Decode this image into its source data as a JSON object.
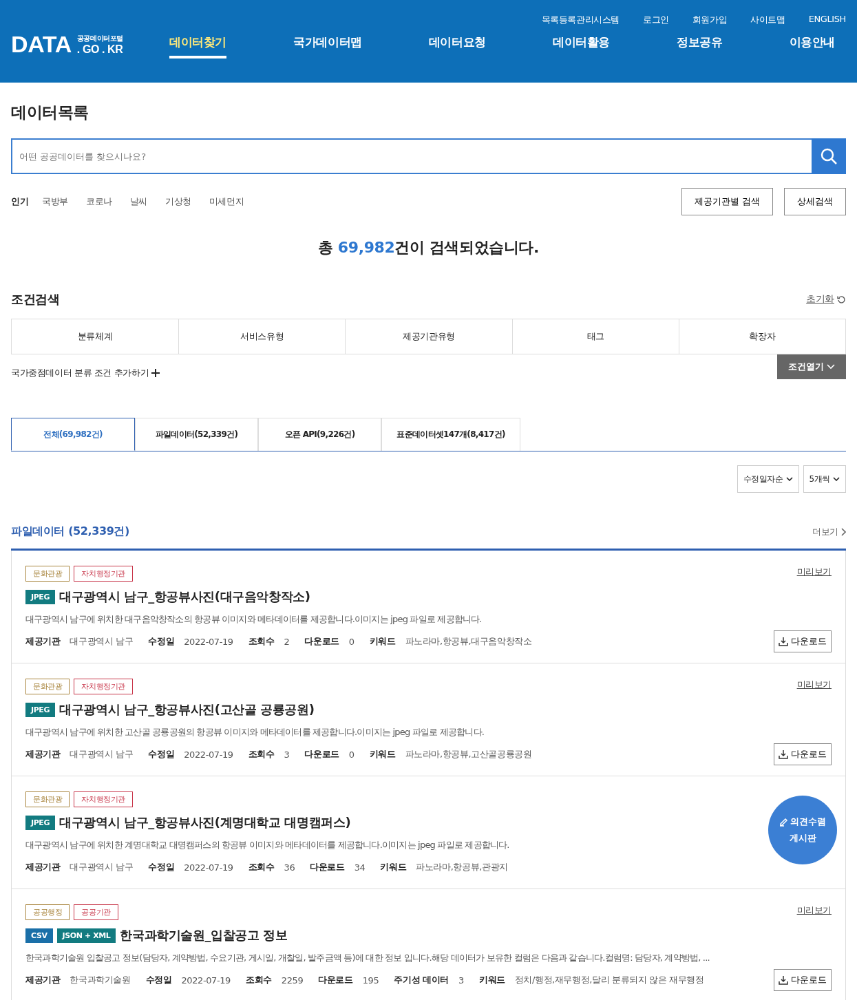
{
  "header": {
    "logo": {
      "main": "DATA",
      "sub_top": "공공데이터포털",
      "sub_bottom": ". GO . KR"
    },
    "util_links": [
      "목록등록관리시스템",
      "로그인",
      "회원가입",
      "사이트맵",
      "ENGLISH"
    ],
    "nav": [
      {
        "label": "데이터찾기",
        "selected": true
      },
      {
        "label": "국가데이터맵",
        "selected": false
      },
      {
        "label": "데이터요청",
        "selected": false
      },
      {
        "label": "데이터활용",
        "selected": false
      },
      {
        "label": "정보공유",
        "selected": false
      },
      {
        "label": "이용안내",
        "selected": false
      }
    ]
  },
  "page_title": "데이터목록",
  "search": {
    "placeholder": "어떤 공공데이터를 찾으시나요?"
  },
  "popular": {
    "label": "인기",
    "keywords": [
      "국방부",
      "코로나",
      "날씨",
      "기상청",
      "미세먼지"
    ]
  },
  "search_buttons": [
    "제공기관별 검색",
    "상세검색"
  ],
  "result_summary": {
    "prefix": "총 ",
    "count": "69,982",
    "suffix": "건이 검색되었습니다."
  },
  "condition": {
    "title": "조건검색",
    "reset": "초기화",
    "columns": [
      "분류체계",
      "서비스유형",
      "제공기관유형",
      "태그",
      "확장자"
    ],
    "add_link": "국가중점데이터 분류 조건 추가하기",
    "open_button": "조건열기"
  },
  "tabs": [
    {
      "label": "전체(69,982건)",
      "selected": true
    },
    {
      "label": "파일데이터(52,339건)",
      "selected": false
    },
    {
      "label": "오픈 API(9,226건)",
      "selected": false
    },
    {
      "label": "표준데이터셋147개(8,417건)",
      "selected": false
    }
  ],
  "sort_selects": [
    "수정일자순",
    "5개씩"
  ],
  "section": {
    "title": "파일데이터 (52,339건)",
    "more": "더보기"
  },
  "items": [
    {
      "tags": [
        {
          "label": "문화관광",
          "color": "#a8843c"
        },
        {
          "label": "자치행정기관",
          "color": "#c8364a"
        }
      ],
      "formats": [
        {
          "label": "JPEG",
          "color": "#127b80"
        }
      ],
      "title": "대구광역시 남구_항공뷰사진(대구음악창작소)",
      "description": "대구광역시 남구에 위치한 대구음악창작소의 항공뷰 이미지와 메타데이터를 제공합니다.이미지는 jpeg 파일로 제공합니다.",
      "meta": [
        {
          "label": "제공기관",
          "value": "대구광역시 남구"
        },
        {
          "label": "수정일",
          "value": "2022-07-19"
        },
        {
          "label": "조회수",
          "value": "2"
        },
        {
          "label": "다운로드",
          "value": "0"
        },
        {
          "label": "키워드",
          "value": "파노라마,항공뷰,대구음악창작소"
        }
      ],
      "preview": "미리보기",
      "download": "다운로드"
    },
    {
      "tags": [
        {
          "label": "문화관광",
          "color": "#a8843c"
        },
        {
          "label": "자치행정기관",
          "color": "#c8364a"
        }
      ],
      "formats": [
        {
          "label": "JPEG",
          "color": "#127b80"
        }
      ],
      "title": "대구광역시 남구_항공뷰사진(고산골 공룡공원)",
      "description": "대구광역시 남구에 위치한 고산골 공룡공원의 항공뷰 이미지와 메타데이터를 제공합니다.이미지는 jpeg 파일로 제공합니다.",
      "meta": [
        {
          "label": "제공기관",
          "value": "대구광역시 남구"
        },
        {
          "label": "수정일",
          "value": "2022-07-19"
        },
        {
          "label": "조회수",
          "value": "3"
        },
        {
          "label": "다운로드",
          "value": "0"
        },
        {
          "label": "키워드",
          "value": "파노라마,항공뷰,고산골공룡공원"
        }
      ],
      "preview": "미리보기",
      "download": "다운로드"
    },
    {
      "tags": [
        {
          "label": "문화관광",
          "color": "#a8843c"
        },
        {
          "label": "자치행정기관",
          "color": "#c8364a"
        }
      ],
      "formats": [
        {
          "label": "JPEG",
          "color": "#127b80"
        }
      ],
      "title": "대구광역시 남구_항공뷰사진(계명대학교 대명캠퍼스)",
      "description": "대구광역시 남구에 위치한 계명대학교 대명캠퍼스의 항공뷰 이미지와 메타데이터를 제공합니다.이미지는 jpeg 파일로 제공합니다.",
      "meta": [
        {
          "label": "제공기관",
          "value": "대구광역시 남구"
        },
        {
          "label": "수정일",
          "value": "2022-07-19"
        },
        {
          "label": "조회수",
          "value": "36"
        },
        {
          "label": "다운로드",
          "value": "34"
        },
        {
          "label": "키워드",
          "value": "파노라마,항공뷰,관광지"
        }
      ]
    },
    {
      "tags": [
        {
          "label": "공공행정",
          "color": "#a8843c"
        },
        {
          "label": "공공기관",
          "color": "#c8364a"
        }
      ],
      "formats": [
        {
          "label": "CSV",
          "color": "#1a6fa8"
        },
        {
          "label": "JSON + XML",
          "color": "#127b80"
        }
      ],
      "title": "한국과학기술원_입찰공고 정보",
      "description": "한국과학기술원 입찰공고 정보(담당자, 계약방법, 수요기관, 게시일, 개찰일, 발주금액 등)에 대한 정보 입니다.해당 데이터가 보유한 컬럼은 다음과 같습니다.컬럼명: 담당자, 계약방법, ...",
      "meta": [
        {
          "label": "제공기관",
          "value": "한국과학기술원"
        },
        {
          "label": "수정일",
          "value": "2022-07-19"
        },
        {
          "label": "조회수",
          "value": "2259"
        },
        {
          "label": "다운로드",
          "value": "195"
        },
        {
          "label": "주기성 데이터",
          "value": "3"
        },
        {
          "label": "키워드",
          "value": "정치/행정,재무행정,달리 분류되지 않은 재무행정"
        }
      ],
      "preview": "미리보기",
      "download": "다운로드"
    }
  ],
  "floating_button": {
    "line1": "의견수렴",
    "line2": "게시판"
  }
}
